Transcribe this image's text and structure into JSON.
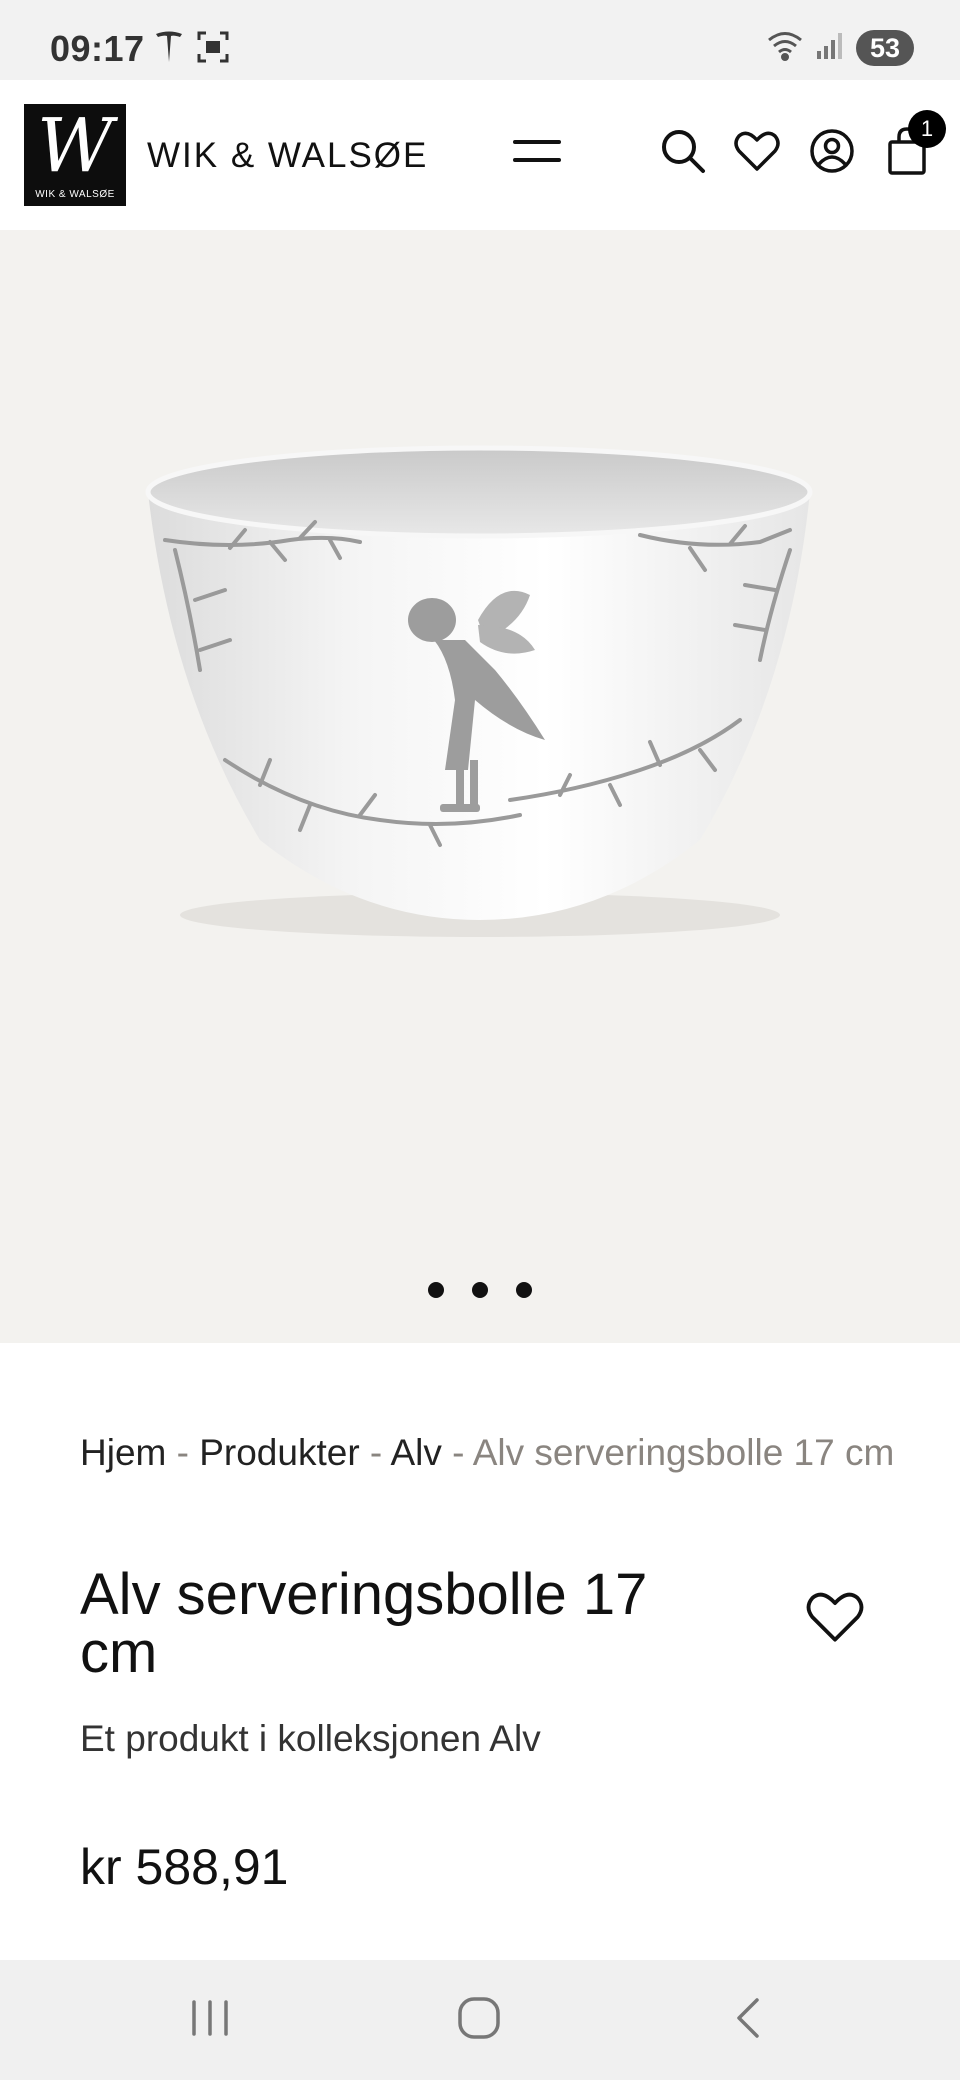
{
  "status_bar": {
    "time": "09:17",
    "battery": "53",
    "icons": [
      "tesla-icon",
      "screenshot-icon",
      "wifi-icon",
      "signal-icon"
    ]
  },
  "header": {
    "logo_letter": "W",
    "logo_caption": "WIK & WALSØE",
    "brand_name": "WIK & WALSØE",
    "cart_count": "1",
    "icons": [
      "menu-icon",
      "search-icon",
      "heart-icon",
      "account-icon",
      "cart-icon"
    ]
  },
  "gallery": {
    "slide_count": 3,
    "active_slide": 1,
    "image_subject": "white porcelain bowl with grey fairy and branch motif"
  },
  "breadcrumb": {
    "items": [
      "Hjem",
      "Produkter",
      "Alv"
    ],
    "separator": " - ",
    "current": "Alv serveringsbolle 17 cm"
  },
  "product": {
    "title": "Alv serveringsbolle 17 cm",
    "collection_text": "Et produkt i kolleksjonen Alv",
    "price": "kr 588,91"
  },
  "nav_bar": {
    "icons": [
      "recent-apps-icon",
      "home-icon",
      "back-icon"
    ]
  },
  "colors": {
    "hero_bg": "#f3f2ef",
    "muted_text": "#8a8580",
    "status_bar_bg": "#f2f2f2"
  }
}
